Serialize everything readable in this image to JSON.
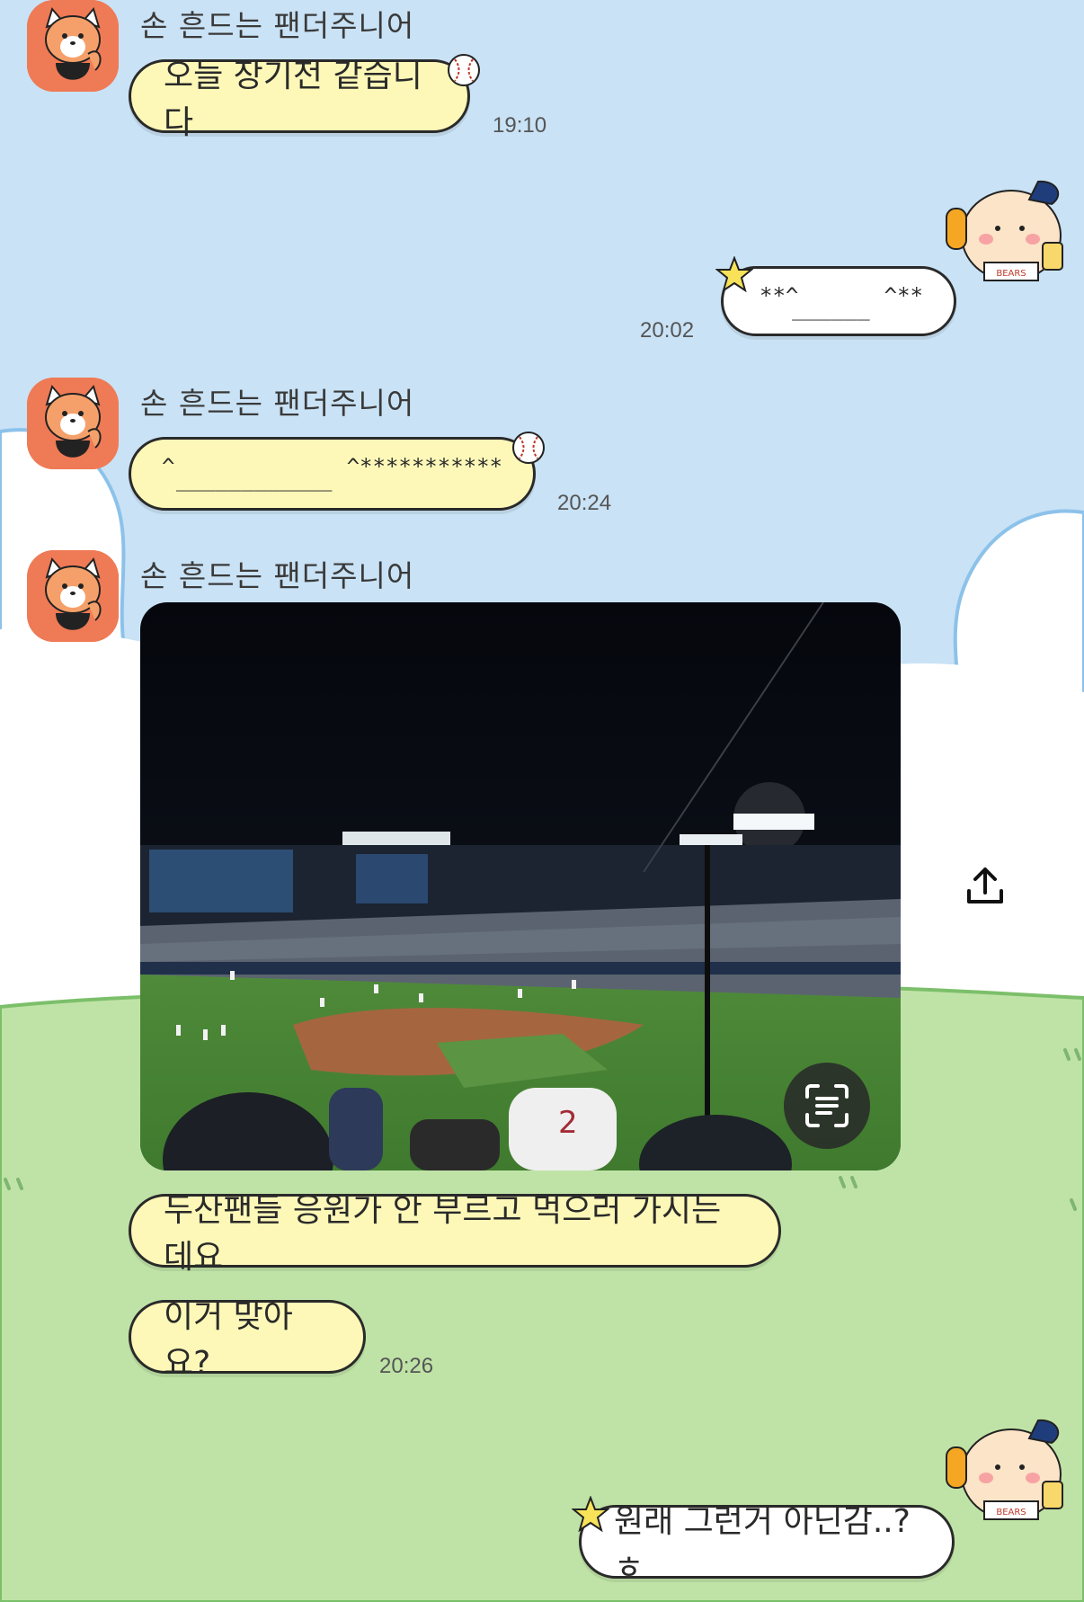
{
  "colors": {
    "sky": "#c9e2f5",
    "grass": "#bfe3a6",
    "bubble_yellow": "#fdf8b8",
    "bubble_white": "#ffffff",
    "avatar": "#ef7a56"
  },
  "messages": [
    {
      "sender": "손 흔드는 팬더주니어",
      "text": "오늘 장기전 같습니다",
      "time": "19:10"
    },
    {
      "mine": true,
      "text_top": "**^",
      "text_top_right": "^**",
      "text_bottom": "______",
      "time": "20:02"
    },
    {
      "sender": "손 흔드는 팬더주니어",
      "text_top": "^",
      "text_top_right": "^***********",
      "text_bottom": "____________",
      "time": "20:24"
    },
    {
      "sender": "손 흔드는 팬더주니어",
      "image": "baseball-stadium-night-photo",
      "followups": [
        "두산팬들 응원가 안 부르고 먹으러 가시는데요",
        "이거 맞아요?"
      ],
      "time": "20:26"
    },
    {
      "mine": true,
      "text": "원래 그런거 아닌감..?ㅎ"
    }
  ],
  "icons": {
    "share": "share-upload-icon",
    "text_scan": "text-scan-icon"
  }
}
